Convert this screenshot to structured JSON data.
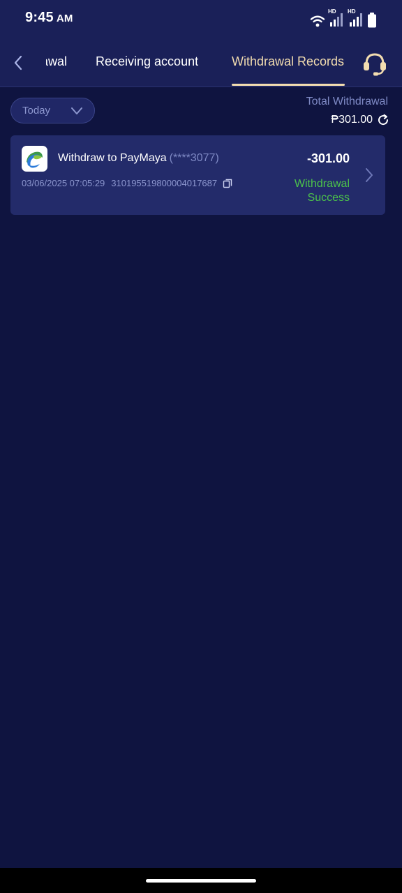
{
  "status_bar": {
    "time": "9:45",
    "ampm": "AM",
    "network_label_1": "HD",
    "network_label_2": "HD"
  },
  "nav": {
    "tabs": [
      {
        "label": "Withdrawal"
      },
      {
        "label": "Receiving account"
      },
      {
        "label": "Withdrawal Records"
      }
    ],
    "active_tab": 2
  },
  "filter": {
    "selected": "Today"
  },
  "summary": {
    "label": "Total Withdrawal",
    "amount": "₱301.00"
  },
  "records": [
    {
      "title": "Withdraw to PayMaya",
      "account": "(****3077)",
      "datetime": "03/06/2025 07:05:29",
      "order_id": "3101955198000040176​87",
      "amount": "-301.00",
      "status": "Withdrawal Success"
    }
  ],
  "colors": {
    "background": "#0f1440",
    "header": "#1a2058",
    "card": "#232b6a",
    "accent": "#f3ddb0",
    "success": "#4cc34a",
    "muted": "#7e89c4"
  }
}
